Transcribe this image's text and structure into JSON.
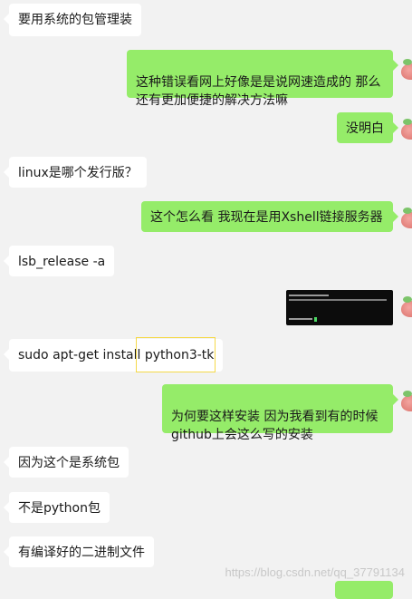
{
  "messages": [
    {
      "side": "left",
      "text": "要用系统的包管理装"
    },
    {
      "side": "right",
      "text": "这种错误看网上好像是是说网速造成的  那么\n还有更加便捷的解决方法嘛"
    },
    {
      "side": "right",
      "text": "没明白"
    },
    {
      "side": "left",
      "text": "linux是哪个发行版？"
    },
    {
      "side": "right",
      "text": "这个怎么看 我现在是用Xshell链接服务器"
    },
    {
      "side": "left",
      "text": "lsb_release -a"
    },
    {
      "side": "left",
      "text": "sudo apt-get install python3-tk"
    },
    {
      "side": "right",
      "text": "为何要这样安装  因为我看到有的时候\ngithub上会这么写的安装"
    },
    {
      "side": "left",
      "text": "因为这个是系统包"
    },
    {
      "side": "left",
      "text": "不是python包"
    },
    {
      "side": "left",
      "text": "有编译好的二进制文件"
    }
  ],
  "watermark": "https://blog.csdn.net/qq_37791134",
  "colors": {
    "sent_bubble": "#95ec69",
    "received_bubble": "#ffffff",
    "background": "#f2f2f2"
  },
  "icons": {
    "avatar": "strawberry-avatar-icon",
    "screenshot": "terminal-screenshot-image"
  }
}
